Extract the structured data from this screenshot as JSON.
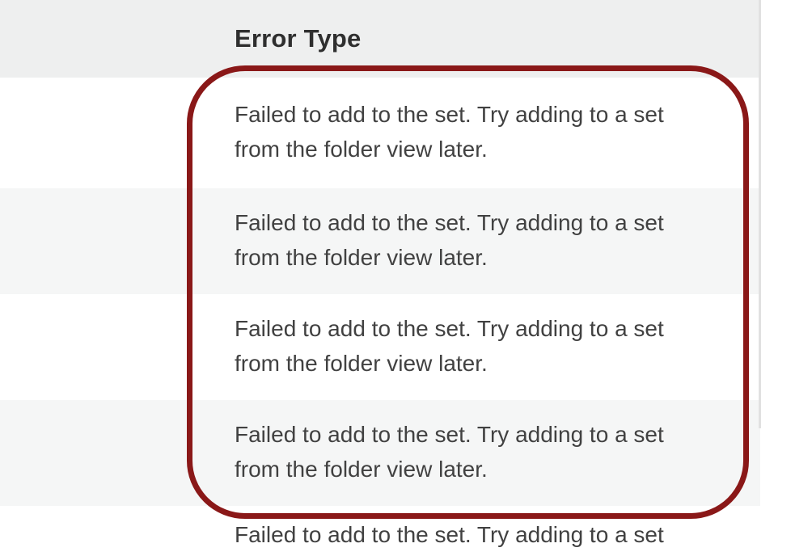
{
  "table": {
    "header": {
      "error_type": "Error Type"
    },
    "rows": [
      {
        "error": "Failed to add to the set. Try adding to a set from the folder view later."
      },
      {
        "error": "Failed to add to the set. Try adding to a set from the folder view later."
      },
      {
        "error": "Failed to add to the set. Try adding to a set from the folder view later."
      },
      {
        "error": "Failed to add to the set. Try adding to a set from the folder view later."
      },
      {
        "error": "Failed to add to the set. Try adding to a set"
      }
    ]
  }
}
